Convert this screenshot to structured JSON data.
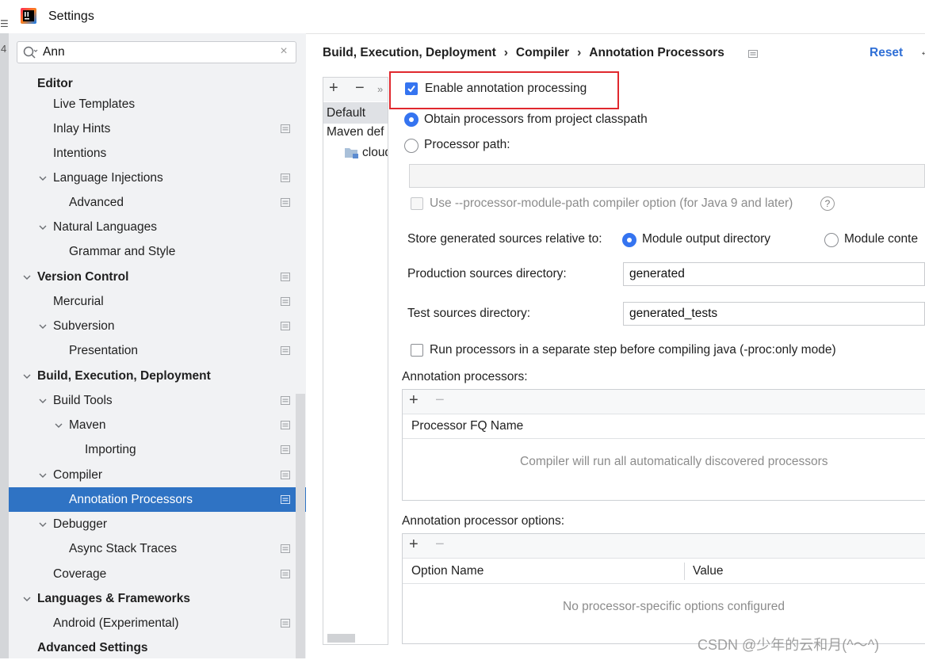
{
  "window": {
    "title": "Settings"
  },
  "search": {
    "value": "Ann"
  },
  "sidebar": {
    "items": [
      {
        "label": "Editor",
        "level": 0,
        "bold": true,
        "expanded": null,
        "proj": false
      },
      {
        "label": "Live Templates",
        "level": 1,
        "bold": false,
        "expanded": null,
        "proj": false
      },
      {
        "label": "Inlay Hints",
        "level": 1,
        "bold": false,
        "expanded": null,
        "proj": true
      },
      {
        "label": "Intentions",
        "level": 1,
        "bold": false,
        "expanded": null,
        "proj": false
      },
      {
        "label": "Language Injections",
        "level": 1,
        "bold": false,
        "expanded": true,
        "proj": true
      },
      {
        "label": "Advanced",
        "level": 2,
        "bold": false,
        "expanded": null,
        "proj": true
      },
      {
        "label": "Natural Languages",
        "level": 1,
        "bold": false,
        "expanded": true,
        "proj": false
      },
      {
        "label": "Grammar and Style",
        "level": 2,
        "bold": false,
        "expanded": null,
        "proj": false
      },
      {
        "label": "Version Control",
        "level": 0,
        "bold": true,
        "expanded": true,
        "proj": true
      },
      {
        "label": "Mercurial",
        "level": 1,
        "bold": false,
        "expanded": null,
        "proj": true
      },
      {
        "label": "Subversion",
        "level": 1,
        "bold": false,
        "expanded": true,
        "proj": true
      },
      {
        "label": "Presentation",
        "level": 2,
        "bold": false,
        "expanded": null,
        "proj": true
      },
      {
        "label": "Build, Execution, Deployment",
        "level": 0,
        "bold": true,
        "expanded": true,
        "proj": false
      },
      {
        "label": "Build Tools",
        "level": 1,
        "bold": false,
        "expanded": true,
        "proj": true
      },
      {
        "label": "Maven",
        "level": 2,
        "bold": false,
        "expanded": true,
        "proj": true
      },
      {
        "label": "Importing",
        "level": 3,
        "bold": false,
        "expanded": null,
        "proj": true
      },
      {
        "label": "Compiler",
        "level": 1,
        "bold": false,
        "expanded": true,
        "proj": true
      },
      {
        "label": "Annotation Processors",
        "level": 2,
        "bold": false,
        "expanded": null,
        "proj": true,
        "selected": true
      },
      {
        "label": "Debugger",
        "level": 1,
        "bold": false,
        "expanded": true,
        "proj": false
      },
      {
        "label": "Async Stack Traces",
        "level": 2,
        "bold": false,
        "expanded": null,
        "proj": true
      },
      {
        "label": "Coverage",
        "level": 1,
        "bold": false,
        "expanded": null,
        "proj": true
      },
      {
        "label": "Languages & Frameworks",
        "level": 0,
        "bold": true,
        "expanded": true,
        "proj": false
      },
      {
        "label": "Android (Experimental)",
        "level": 1,
        "bold": false,
        "expanded": null,
        "proj": true
      },
      {
        "label": "Advanced Settings",
        "level": 0,
        "bold": true,
        "expanded": null,
        "proj": false
      }
    ]
  },
  "breadcrumb": {
    "part1": "Build, Execution, Deployment",
    "part2": "Compiler",
    "part3": "Annotation Processors",
    "sep": "›"
  },
  "header": {
    "reset_label": "Reset"
  },
  "profiles": {
    "add": "+",
    "remove": "−",
    "more": "»",
    "items": [
      "Default",
      "Maven def",
      "cloud"
    ]
  },
  "options": {
    "enable_annotation": {
      "label": "Enable annotation processing",
      "checked": true
    },
    "obtain_classpath": {
      "label": "Obtain processors from project classpath",
      "checked": true
    },
    "processor_path": {
      "label": "Processor path:",
      "checked": false,
      "value": ""
    },
    "module_path": {
      "label": "Use --processor-module-path compiler option (for Java 9 and later)",
      "checked": false,
      "help": "?"
    },
    "store_relative": {
      "label": "Store generated sources relative to:",
      "opt1": "Module output directory",
      "opt2": "Module conte"
    },
    "production_dir": {
      "label": "Production sources directory:",
      "value": "generated"
    },
    "test_dir": {
      "label": "Test sources directory:",
      "value": "generated_tests"
    },
    "separate_step": {
      "label": "Run processors in a separate step before compiling java (-proc:only mode)",
      "checked": false
    }
  },
  "annotation_processors": {
    "title": "Annotation processors:",
    "add": "+",
    "remove": "−",
    "column": "Processor FQ Name",
    "empty_text": "Compiler will run all automatically discovered processors"
  },
  "processor_options": {
    "title": "Annotation processor options:",
    "add": "+",
    "remove": "−",
    "col_name": "Option Name",
    "col_value": "Value",
    "empty_text": "No processor-specific options configured"
  },
  "watermark": "CSDN @少年的云和月(^～^)",
  "colors": {
    "accent": "#3574f0",
    "selection": "#2f73c4",
    "highlight": "#e0282e",
    "link": "#2f6fd6"
  }
}
